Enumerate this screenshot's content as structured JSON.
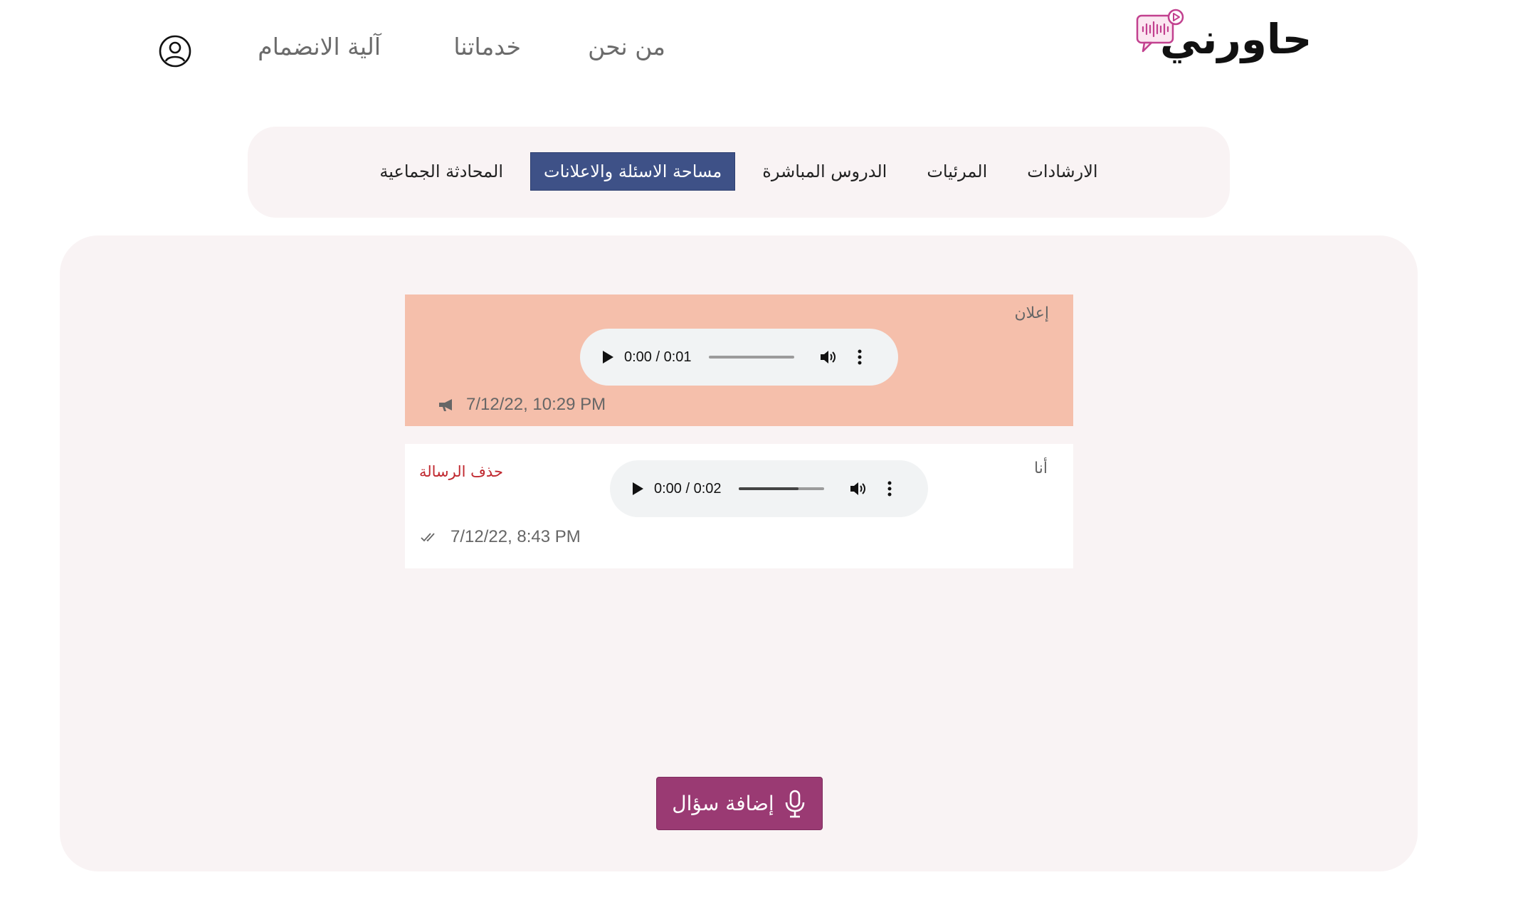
{
  "header": {
    "logo_text": "حاورني",
    "nav": {
      "about": "من نحن",
      "services": "خدماتنا",
      "join": "آلية الانضمام"
    },
    "user_icon": "user-circle-icon"
  },
  "tabs": {
    "group_chat": "المحادثة الجماعية",
    "questions_announcements": "مساحة الاسئلة والاعلانات",
    "live_lessons": "الدروس المباشرة",
    "videos": "المرئيات",
    "guidance": "الارشادات",
    "active": "questions_announcements"
  },
  "messages": {
    "announcement": {
      "sender": "إعلان",
      "audio_time": "0:00 / 0:01",
      "audio_progress": 0,
      "timestamp": "7/12/22, 10:29 PM",
      "icon": "megaphone-icon"
    },
    "mine": {
      "sender": "أنا",
      "audio_time": "0:00 / 0:02",
      "audio_progress": 0.7,
      "timestamp": "7/12/22, 8:43 PM",
      "delete_label": "حذف الرسالة",
      "icon": "double-check-icon"
    }
  },
  "actions": {
    "add_question": "إضافة سؤال",
    "add_question_icon": "microphone-icon"
  },
  "colors": {
    "active_tab": "#3e5187",
    "announcement_bg": "#f5bfab",
    "delete_text": "#c0282f",
    "primary_button": "#9a3a73",
    "panel_bg": "#f9f3f4",
    "logo_accent": "#c2418f"
  }
}
